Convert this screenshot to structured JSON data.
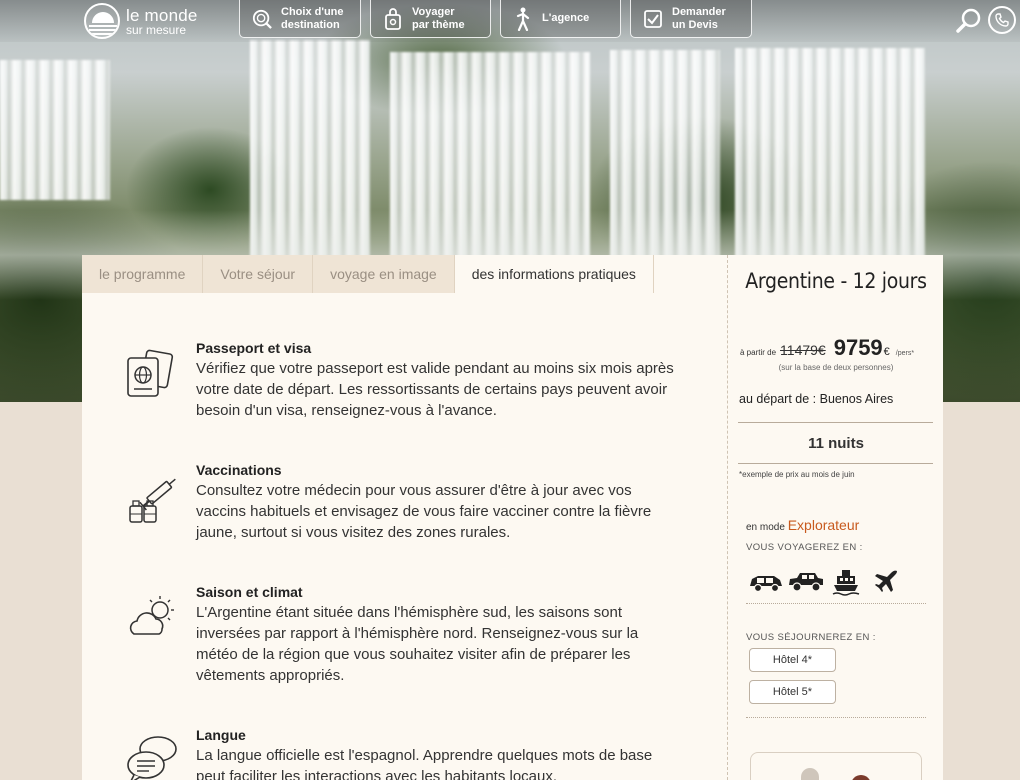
{
  "brand": {
    "line1": "le monde",
    "line2": "sur mesure"
  },
  "nav": [
    {
      "label": "Choix d'une\ndestination",
      "icon": "search-globe-icon"
    },
    {
      "label": "Voyager\npar thème",
      "icon": "bag-icon"
    },
    {
      "label": "L'agence",
      "icon": "person-icon"
    },
    {
      "label": "Demander\nun Devis",
      "icon": "checkbox-icon"
    }
  ],
  "tabs": [
    {
      "label": "le programme",
      "active": false
    },
    {
      "label": "Votre séjour",
      "active": false
    },
    {
      "label": "voyage en image",
      "active": false
    },
    {
      "label": "des informations pratiques",
      "active": true
    }
  ],
  "sections": [
    {
      "icon": "passport-icon",
      "title": "Passeport et visa",
      "text": "Vérifiez que votre passeport est valide pendant au moins six mois après votre date de départ. Les ressortissants de certains pays peuvent avoir besoin d'un visa, renseignez-vous à l'avance."
    },
    {
      "icon": "vaccine-icon",
      "title": "Vaccinations",
      "text": "Consultez votre médecin pour vous assurer d'être à jour avec vos vaccins habituels et envisagez de vous faire vacciner contre la fièvre jaune, surtout si vous visitez des zones rurales."
    },
    {
      "icon": "weather-icon",
      "title": "Saison et climat",
      "text": "L'Argentine étant située dans l'hémisphère sud, les saisons sont inversées par rapport à l'hémisphère nord. Renseignez-vous sur la météo de la région que vous souhaitez visiter afin de préparer les vêtements appropriés."
    },
    {
      "icon": "speech-bubbles-icon",
      "title": "Langue",
      "text": "La langue officielle est l'espagnol. Apprendre quelques mots de base peut faciliter les interactions avec les habitants locaux."
    }
  ],
  "sidebar": {
    "title": "Argentine - 12 jours",
    "price_from": "à partir de",
    "old_price": "11479€",
    "new_price": "9759",
    "currency": "€",
    "per_person": "/pers*",
    "price_note": "(sur la base de deux personnes)",
    "depart": "au départ de : Buenos Aires",
    "nights": "11 nuits",
    "example_note": "*exemple de prix au mois de juin",
    "mode_prefix": "en mode",
    "mode_value": "Explorateur",
    "travel_label": "VOUS VOYAGEREZ EN :",
    "transports": [
      "car-icon",
      "suv-icon",
      "ferry-icon",
      "plane-icon"
    ],
    "stay_label": "VOUS SÉJOURNEREZ EN :",
    "hotels": [
      "Hôtel 4*",
      "Hôtel 5*"
    ]
  },
  "colors": {
    "accent": "#c85a1e",
    "card_bg": "#fdf9f2",
    "tab_bg": "#efe4d5",
    "page_bg": "#e9dfd3"
  }
}
